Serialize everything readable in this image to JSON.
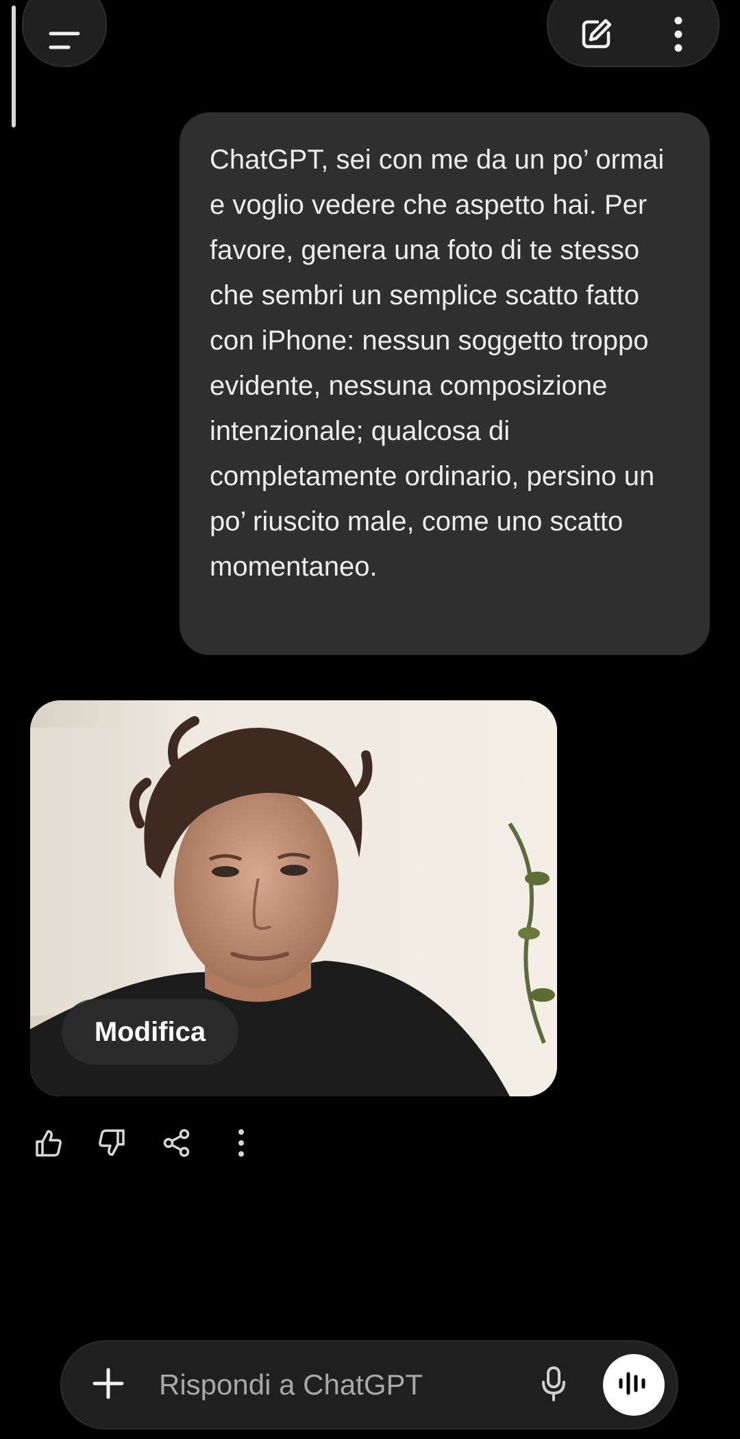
{
  "header": {
    "menu_icon": "menu-icon",
    "new_chat_icon": "edit-icon",
    "more_icon": "more-vertical-icon"
  },
  "conversation": {
    "user_message": "ChatGPT, sei con me da un po’ ormai e voglio vedere che aspetto hai. Per favore, genera una foto di te stesso che sembri un semplice scatto fatto con iPhone: nessun soggetto troppo evidente, nessuna composizione intenzionale; qualcosa di completamente ordinario, persino un po’ riuscito male, come uno scatto momentaneo.",
    "generated_image": {
      "edit_label": "Modifica"
    },
    "actions": [
      "thumbs-up-icon",
      "thumbs-down-icon",
      "share-icon",
      "more-vertical-icon"
    ]
  },
  "composer": {
    "placeholder": "Rispondi a ChatGPT",
    "add_icon": "plus-icon",
    "mic_icon": "microphone-icon",
    "voice_icon": "voice-mode-icon"
  },
  "colors": {
    "background": "#000000",
    "user_bubble": "#2f2f2f",
    "composer": "#1f1f1f"
  }
}
